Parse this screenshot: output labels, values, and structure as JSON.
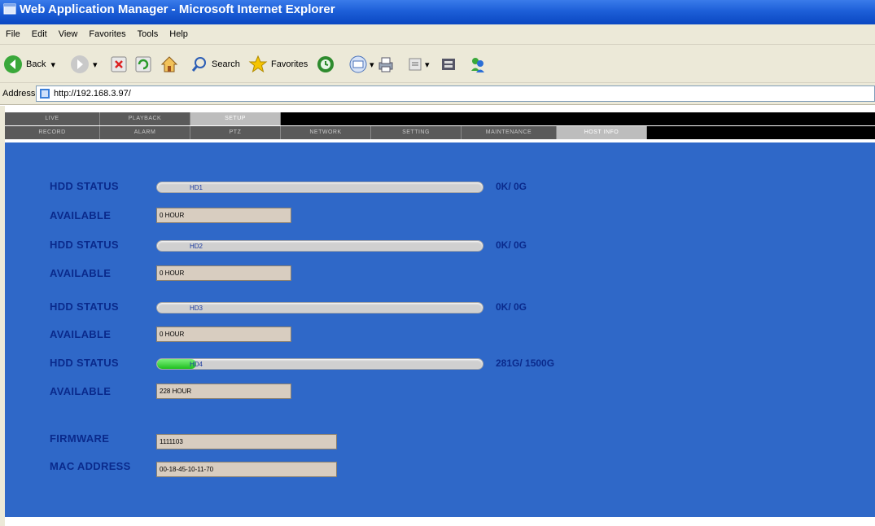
{
  "window": {
    "title": "Web Application Manager - Microsoft Internet Explorer"
  },
  "menu": [
    "File",
    "Edit",
    "View",
    "Favorites",
    "Tools",
    "Help"
  ],
  "toolbar": {
    "back_label": "Back",
    "search_label": "Search",
    "favorites_label": "Favorites"
  },
  "address": {
    "label": "Address",
    "url": "http://192.168.3.97/"
  },
  "tabs_top": [
    {
      "label": "LIVE",
      "active": false
    },
    {
      "label": "PLAYBACK",
      "active": false
    },
    {
      "label": "SETUP",
      "active": true
    }
  ],
  "tabs_sub": [
    {
      "label": "RECORD",
      "active": false
    },
    {
      "label": "ALARM",
      "active": false
    },
    {
      "label": "PTZ",
      "active": false
    },
    {
      "label": "NETWORK",
      "active": false
    },
    {
      "label": "SETTING",
      "active": false
    },
    {
      "label": "MAINTENANCE",
      "active": false
    },
    {
      "label": "HOST INFO",
      "active": true
    }
  ],
  "hdds": [
    {
      "status_label": "HDD STATUS",
      "bar_label": "HD1",
      "fill_fraction": 0.0,
      "capacity": "0K/ 0G",
      "available_label": "AVAILABLE",
      "available_value": "0 HOUR"
    },
    {
      "status_label": "HDD STATUS",
      "bar_label": "HD2",
      "fill_fraction": 0.0,
      "capacity": "0K/ 0G",
      "available_label": "AVAILABLE",
      "available_value": "0 HOUR"
    },
    {
      "status_label": "HDD STATUS",
      "bar_label": "HD3",
      "fill_fraction": 0.0,
      "capacity": "0K/ 0G",
      "available_label": "AVAILABLE",
      "available_value": "0 HOUR"
    },
    {
      "status_label": "HDD STATUS",
      "bar_label": "HD4",
      "fill_fraction": 0.12,
      "capacity": "281G/ 1500G",
      "available_label": "AVAILABLE",
      "available_value": "228 HOUR"
    }
  ],
  "firmware": {
    "label": "FIRMWARE",
    "value": "1111103"
  },
  "mac": {
    "label": "MAC ADDRESS",
    "value": "00-18-45-10-11-70"
  },
  "colors": {
    "panel": "#2f68c8",
    "progress_fill": "#1fbf1f",
    "label_text": "#0a2a8c"
  }
}
